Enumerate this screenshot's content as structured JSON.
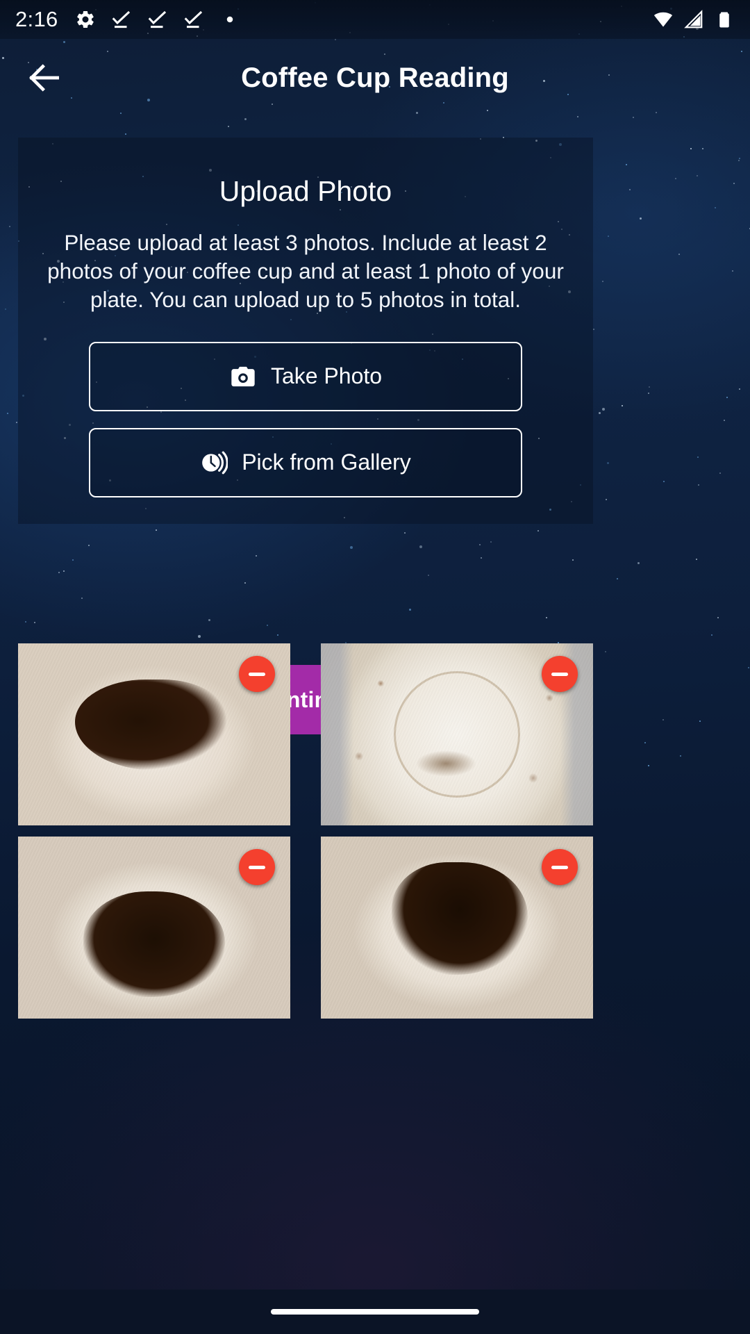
{
  "status_bar": {
    "time": "2:16",
    "left_icons": [
      "gear-icon",
      "task-complete-icon",
      "task-complete-icon",
      "task-complete-icon",
      "dot-icon"
    ],
    "right_icons": [
      "wifi-icon",
      "cellular-signal-icon",
      "battery-icon"
    ]
  },
  "app_bar": {
    "back_label": "back-arrow",
    "title": "Coffee Cup Reading"
  },
  "upload_card": {
    "title": "Upload Photo",
    "description": "Please upload at least 3 photos. Include at least 2 photos of your coffee cup and at least 1 photo of your plate. You can upload up to 5 photos in total.",
    "take_photo_label": "Take Photo",
    "pick_gallery_label": "Pick from Gallery"
  },
  "continue_button": {
    "label": "Continue",
    "color": "#a32ba8"
  },
  "photos": [
    {
      "alt": "coffee-cup-with-dark-grounds",
      "remove_label": "remove-photo"
    },
    {
      "alt": "decorated-plate-with-coffee-residue",
      "remove_label": "remove-photo"
    },
    {
      "alt": "coffee-cup-with-dark-grounds",
      "remove_label": "remove-photo"
    },
    {
      "alt": "coffee-cup-with-dark-grounds",
      "remove_label": "remove-photo"
    }
  ],
  "colors": {
    "accent": "#a32ba8",
    "remove_badge": "#f4402e",
    "background_dark": "#0d1d36",
    "text_primary": "#ffffff"
  },
  "nav_bar": {
    "pill": "home-indicator"
  }
}
